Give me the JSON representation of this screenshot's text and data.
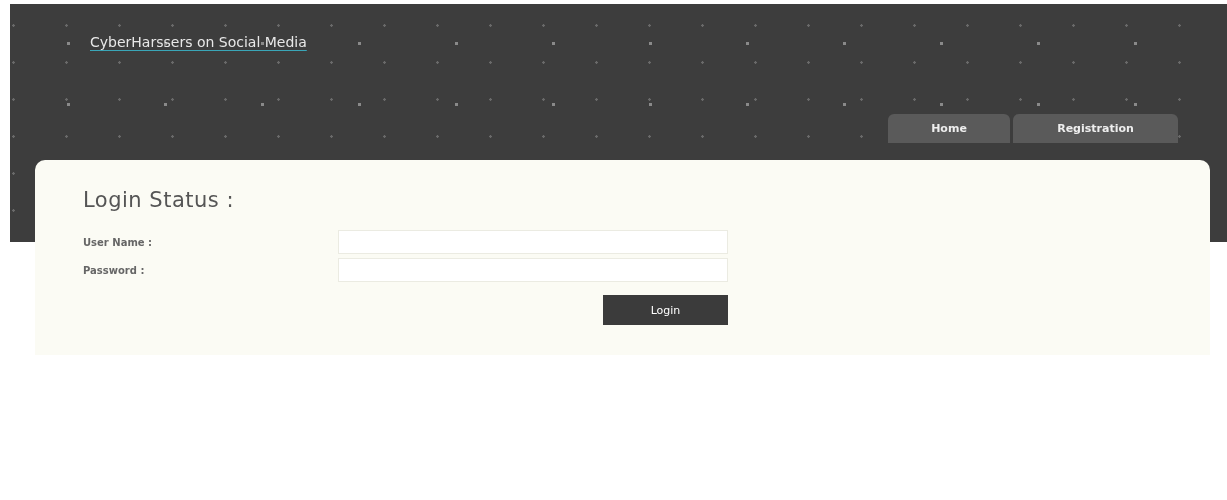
{
  "site_title": "CyberHarssers on Social Media",
  "nav": [
    {
      "label": "Home"
    },
    {
      "label": "Registration"
    }
  ],
  "form": {
    "title": "Login Status :",
    "fields": [
      {
        "label": "User Name :"
      },
      {
        "label": "Password :"
      }
    ],
    "submit": "Login"
  }
}
